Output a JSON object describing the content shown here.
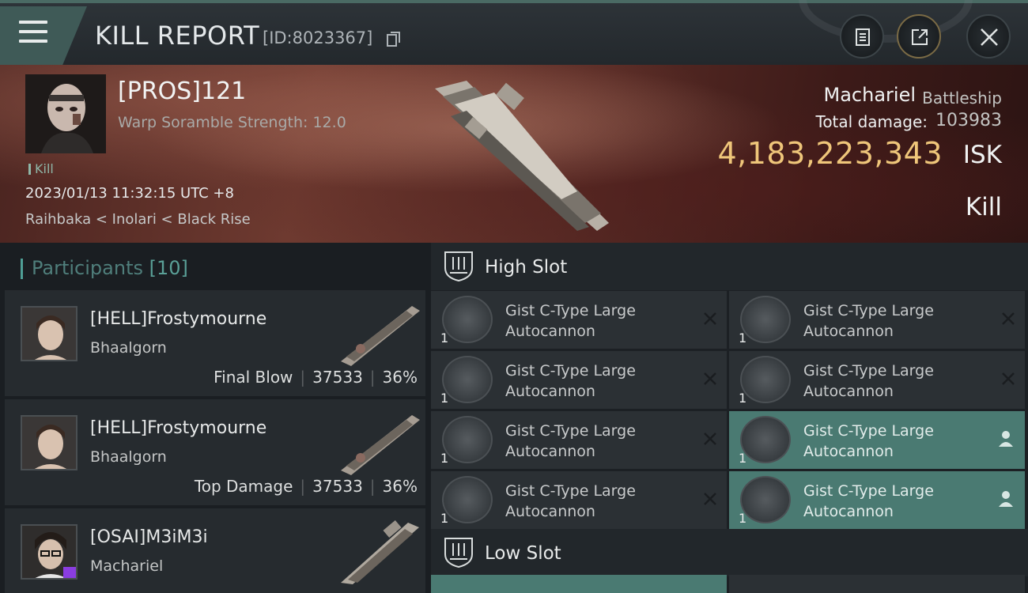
{
  "header": {
    "title": "KILL REPORT",
    "report_id": "[ID:8023367]"
  },
  "victim": {
    "name": "[PROS]121",
    "scramble": "Warp Soramble Strength: 12.0",
    "kill_tag": "Kill",
    "datetime": "2023/01/13 11:32:15 UTC +8",
    "location": "Raihbaka < Inolari < Black Rise",
    "ship_name": "Machariel",
    "ship_class": "Battleship",
    "damage_label": "Total damage:",
    "damage_value": "103983",
    "isk_value": "4,183,223,343",
    "isk_unit": "ISK",
    "result": "Kill"
  },
  "participants": {
    "title": "Participants",
    "count": "[10]",
    "rows": [
      {
        "name": "[HELL]Frostymourne",
        "ship": "Bhaalgorn",
        "role": "Final Blow",
        "damage": "37533",
        "percent": "36%"
      },
      {
        "name": "[HELL]Frostymourne",
        "ship": "Bhaalgorn",
        "role": "Top Damage",
        "damage": "37533",
        "percent": "36%"
      },
      {
        "name": "[OSAI]M3iM3i",
        "ship": "Machariel",
        "role": "",
        "damage": "",
        "percent": ""
      }
    ]
  },
  "slots": {
    "high_title": "High Slot",
    "low_title": "Low Slot",
    "high_modules": [
      {
        "name": "Gist C-Type Large Autocannon",
        "qty": "1",
        "state": "destroyed"
      },
      {
        "name": "Gist C-Type Large Autocannon",
        "qty": "1",
        "state": "destroyed"
      },
      {
        "name": "Gist C-Type Large Autocannon",
        "qty": "1",
        "state": "destroyed"
      },
      {
        "name": "Gist C-Type Large Autocannon",
        "qty": "1",
        "state": "destroyed"
      },
      {
        "name": "Gist C-Type Large Autocannon",
        "qty": "1",
        "state": "destroyed"
      },
      {
        "name": "Gist C-Type Large Autocannon",
        "qty": "1",
        "state": "dropped"
      },
      {
        "name": "Gist C-Type Large Autocannon",
        "qty": "1",
        "state": "destroyed"
      },
      {
        "name": "Gist C-Type Large Autocannon",
        "qty": "1",
        "state": "dropped"
      }
    ]
  },
  "colors": {
    "accent": "#4f9f96",
    "isk": "#efc67a",
    "fitted": "#4a7a72"
  }
}
